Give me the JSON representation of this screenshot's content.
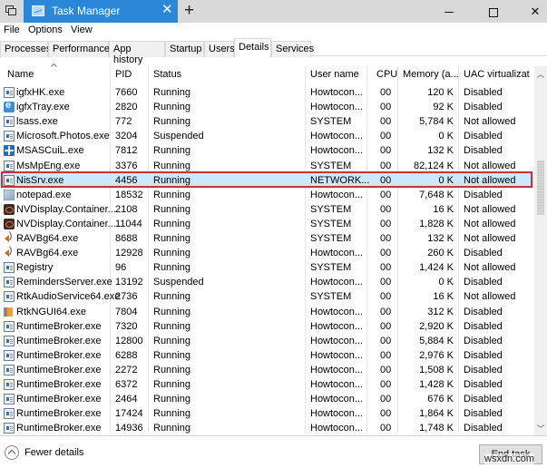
{
  "window": {
    "title": "Task Manager",
    "new_tab_symbol": "+",
    "tab_close_symbol": "✕",
    "close_symbol": "✕"
  },
  "menu": [
    "File",
    "Options",
    "View"
  ],
  "tabs": [
    "Processes",
    "Performance",
    "App history",
    "Startup",
    "Users",
    "Details",
    "Services"
  ],
  "active_tab": "Details",
  "columns": {
    "name": "Name",
    "pid": "PID",
    "status": "Status",
    "user": "User name",
    "cpu": "CPU",
    "memory": "Memory (a...",
    "uac": "UAC virtualizat"
  },
  "sorted_column": "Name",
  "rows": [
    {
      "icon": "generic",
      "name": "igfxHK.exe",
      "pid": "7660",
      "status": "Running",
      "user": "Howtocon...",
      "cpu": "00",
      "memory": "120 K",
      "uac": "Disabled"
    },
    {
      "icon": "tray",
      "name": "igfxTray.exe",
      "pid": "2820",
      "status": "Running",
      "user": "Howtocon...",
      "cpu": "00",
      "memory": "92 K",
      "uac": "Disabled"
    },
    {
      "icon": "generic",
      "name": "lsass.exe",
      "pid": "772",
      "status": "Running",
      "user": "SYSTEM",
      "cpu": "00",
      "memory": "5,784 K",
      "uac": "Not allowed"
    },
    {
      "icon": "generic",
      "name": "Microsoft.Photos.exe",
      "pid": "3204",
      "status": "Suspended",
      "user": "Howtocon...",
      "cpu": "00",
      "memory": "0 K",
      "uac": "Disabled"
    },
    {
      "icon": "shield",
      "name": "MSASCuiL.exe",
      "pid": "7812",
      "status": "Running",
      "user": "Howtocon...",
      "cpu": "00",
      "memory": "132 K",
      "uac": "Disabled"
    },
    {
      "icon": "generic",
      "name": "MsMpEng.exe",
      "pid": "3376",
      "status": "Running",
      "user": "SYSTEM",
      "cpu": "00",
      "memory": "82,124 K",
      "uac": "Not allowed"
    },
    {
      "icon": "generic",
      "name": "NisSrv.exe",
      "pid": "4456",
      "status": "Running",
      "user": "NETWORK...",
      "cpu": "00",
      "memory": "0 K",
      "uac": "Not allowed",
      "selected": true
    },
    {
      "icon": "notepad",
      "name": "notepad.exe",
      "pid": "18532",
      "status": "Running",
      "user": "Howtocon...",
      "cpu": "00",
      "memory": "7,648 K",
      "uac": "Disabled"
    },
    {
      "icon": "nvidia",
      "name": "NVDisplay.Container...",
      "pid": "2108",
      "status": "Running",
      "user": "SYSTEM",
      "cpu": "00",
      "memory": "16 K",
      "uac": "Not allowed"
    },
    {
      "icon": "nvidia",
      "name": "NVDisplay.Container...",
      "pid": "11044",
      "status": "Running",
      "user": "SYSTEM",
      "cpu": "00",
      "memory": "1,828 K",
      "uac": "Not allowed"
    },
    {
      "icon": "speaker",
      "name": "RAVBg64.exe",
      "pid": "8688",
      "status": "Running",
      "user": "SYSTEM",
      "cpu": "00",
      "memory": "132 K",
      "uac": "Not allowed"
    },
    {
      "icon": "speaker",
      "name": "RAVBg64.exe",
      "pid": "12928",
      "status": "Running",
      "user": "Howtocon...",
      "cpu": "00",
      "memory": "260 K",
      "uac": "Disabled"
    },
    {
      "icon": "generic",
      "name": "Registry",
      "pid": "96",
      "status": "Running",
      "user": "SYSTEM",
      "cpu": "00",
      "memory": "1,424 K",
      "uac": "Not allowed"
    },
    {
      "icon": "generic",
      "name": "RemindersServer.exe",
      "pid": "13192",
      "status": "Suspended",
      "user": "Howtocon...",
      "cpu": "00",
      "memory": "0 K",
      "uac": "Disabled"
    },
    {
      "icon": "generic",
      "name": "RtkAudioService64.exe",
      "pid": "2736",
      "status": "Running",
      "user": "SYSTEM",
      "cpu": "00",
      "memory": "16 K",
      "uac": "Not allowed"
    },
    {
      "icon": "rtk",
      "name": "RtkNGUI64.exe",
      "pid": "7804",
      "status": "Running",
      "user": "Howtocon...",
      "cpu": "00",
      "memory": "312 K",
      "uac": "Disabled"
    },
    {
      "icon": "generic",
      "name": "RuntimeBroker.exe",
      "pid": "7320",
      "status": "Running",
      "user": "Howtocon...",
      "cpu": "00",
      "memory": "2,920 K",
      "uac": "Disabled"
    },
    {
      "icon": "generic",
      "name": "RuntimeBroker.exe",
      "pid": "12800",
      "status": "Running",
      "user": "Howtocon...",
      "cpu": "00",
      "memory": "5,884 K",
      "uac": "Disabled"
    },
    {
      "icon": "generic",
      "name": "RuntimeBroker.exe",
      "pid": "6288",
      "status": "Running",
      "user": "Howtocon...",
      "cpu": "00",
      "memory": "2,976 K",
      "uac": "Disabled"
    },
    {
      "icon": "generic",
      "name": "RuntimeBroker.exe",
      "pid": "2272",
      "status": "Running",
      "user": "Howtocon...",
      "cpu": "00",
      "memory": "1,508 K",
      "uac": "Disabled"
    },
    {
      "icon": "generic",
      "name": "RuntimeBroker.exe",
      "pid": "6372",
      "status": "Running",
      "user": "Howtocon...",
      "cpu": "00",
      "memory": "1,428 K",
      "uac": "Disabled"
    },
    {
      "icon": "generic",
      "name": "RuntimeBroker.exe",
      "pid": "2464",
      "status": "Running",
      "user": "Howtocon...",
      "cpu": "00",
      "memory": "676 K",
      "uac": "Disabled"
    },
    {
      "icon": "generic",
      "name": "RuntimeBroker.exe",
      "pid": "17424",
      "status": "Running",
      "user": "Howtocon...",
      "cpu": "00",
      "memory": "1,864 K",
      "uac": "Disabled"
    },
    {
      "icon": "generic",
      "name": "RuntimeBroker.exe",
      "pid": "14936",
      "status": "Running",
      "user": "Howtocon...",
      "cpu": "00",
      "memory": "1,748 K",
      "uac": "Disabled"
    }
  ],
  "footer": {
    "fewer_details": "Fewer details",
    "end_task": "End task",
    "watermark": "wsxdn.com"
  },
  "colors": {
    "title_tab": "#2b88d8",
    "selection": "#cce8ff",
    "highlight_border": "#c8323b"
  }
}
